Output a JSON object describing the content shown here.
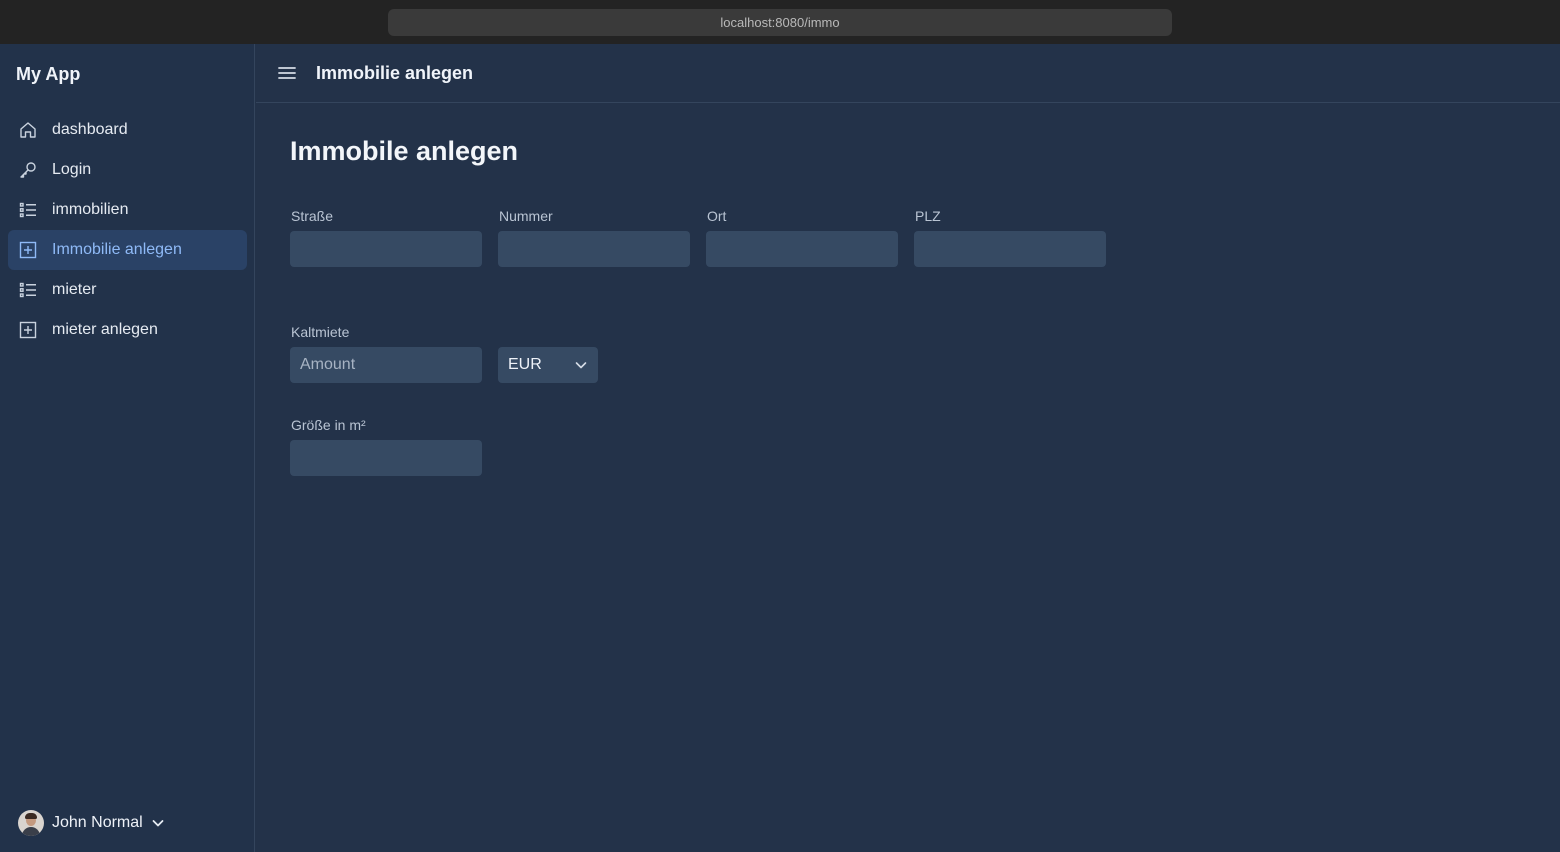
{
  "browser": {
    "url": "localhost:8080/immo"
  },
  "sidebar": {
    "app_title": "My App",
    "items": [
      {
        "label": "dashboard",
        "icon": "home-icon"
      },
      {
        "label": "Login",
        "icon": "key-icon"
      },
      {
        "label": "immobilien",
        "icon": "list-icon"
      },
      {
        "label": "Immobilie anlegen",
        "icon": "plus-square-icon",
        "active": true
      },
      {
        "label": "mieter",
        "icon": "list-icon"
      },
      {
        "label": "mieter anlegen",
        "icon": "plus-square-icon"
      }
    ],
    "user": {
      "name": "John Normal"
    }
  },
  "header": {
    "title": "Immobilie anlegen"
  },
  "form": {
    "title": "Immobile anlegen",
    "strasse": {
      "label": "Straße",
      "value": ""
    },
    "nummer": {
      "label": "Nummer",
      "value": ""
    },
    "ort": {
      "label": "Ort",
      "value": ""
    },
    "plz": {
      "label": "PLZ",
      "value": ""
    },
    "kaltmiete": {
      "label": "Kaltmiete",
      "placeholder": "Amount",
      "currency": "EUR"
    },
    "groesse": {
      "label": "Größe in m²",
      "value": ""
    }
  },
  "colors": {
    "background": "#233249",
    "sidebar": "#22324a",
    "active_item_bg": "#2a4266",
    "active_item_text": "#8fbaf7",
    "input_bg": "#364a63"
  }
}
